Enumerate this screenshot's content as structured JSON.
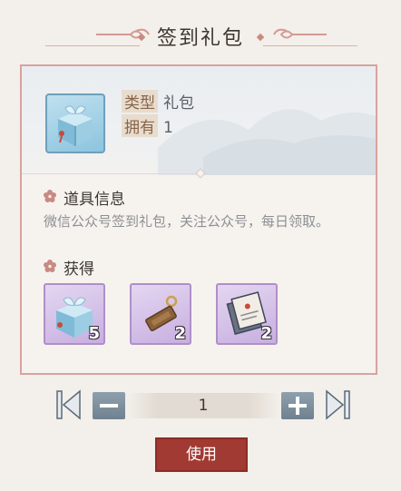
{
  "dialog": {
    "title": "签到礼包"
  },
  "item": {
    "icon": "gift-box-icon",
    "type_label": "类型",
    "type_value": "礼包",
    "owned_label": "拥有",
    "owned_value": "1"
  },
  "details": {
    "title": "道具信息",
    "description": "微信公众号签到礼包，关注公众号，每日领取。"
  },
  "rewards": {
    "title": "获得",
    "items": [
      {
        "icon": "gift-box-icon",
        "count": "5"
      },
      {
        "icon": "wooden-tag-icon",
        "count": "2"
      },
      {
        "icon": "scroll-tickets-icon",
        "count": "2"
      }
    ]
  },
  "quantity": {
    "value": "1"
  },
  "actions": {
    "use_label": "使用"
  },
  "colors": {
    "accent": "#a13a33",
    "panel_border": "#d7a39e",
    "reward_bg": "#c7afe0",
    "background": "#f3efea"
  }
}
